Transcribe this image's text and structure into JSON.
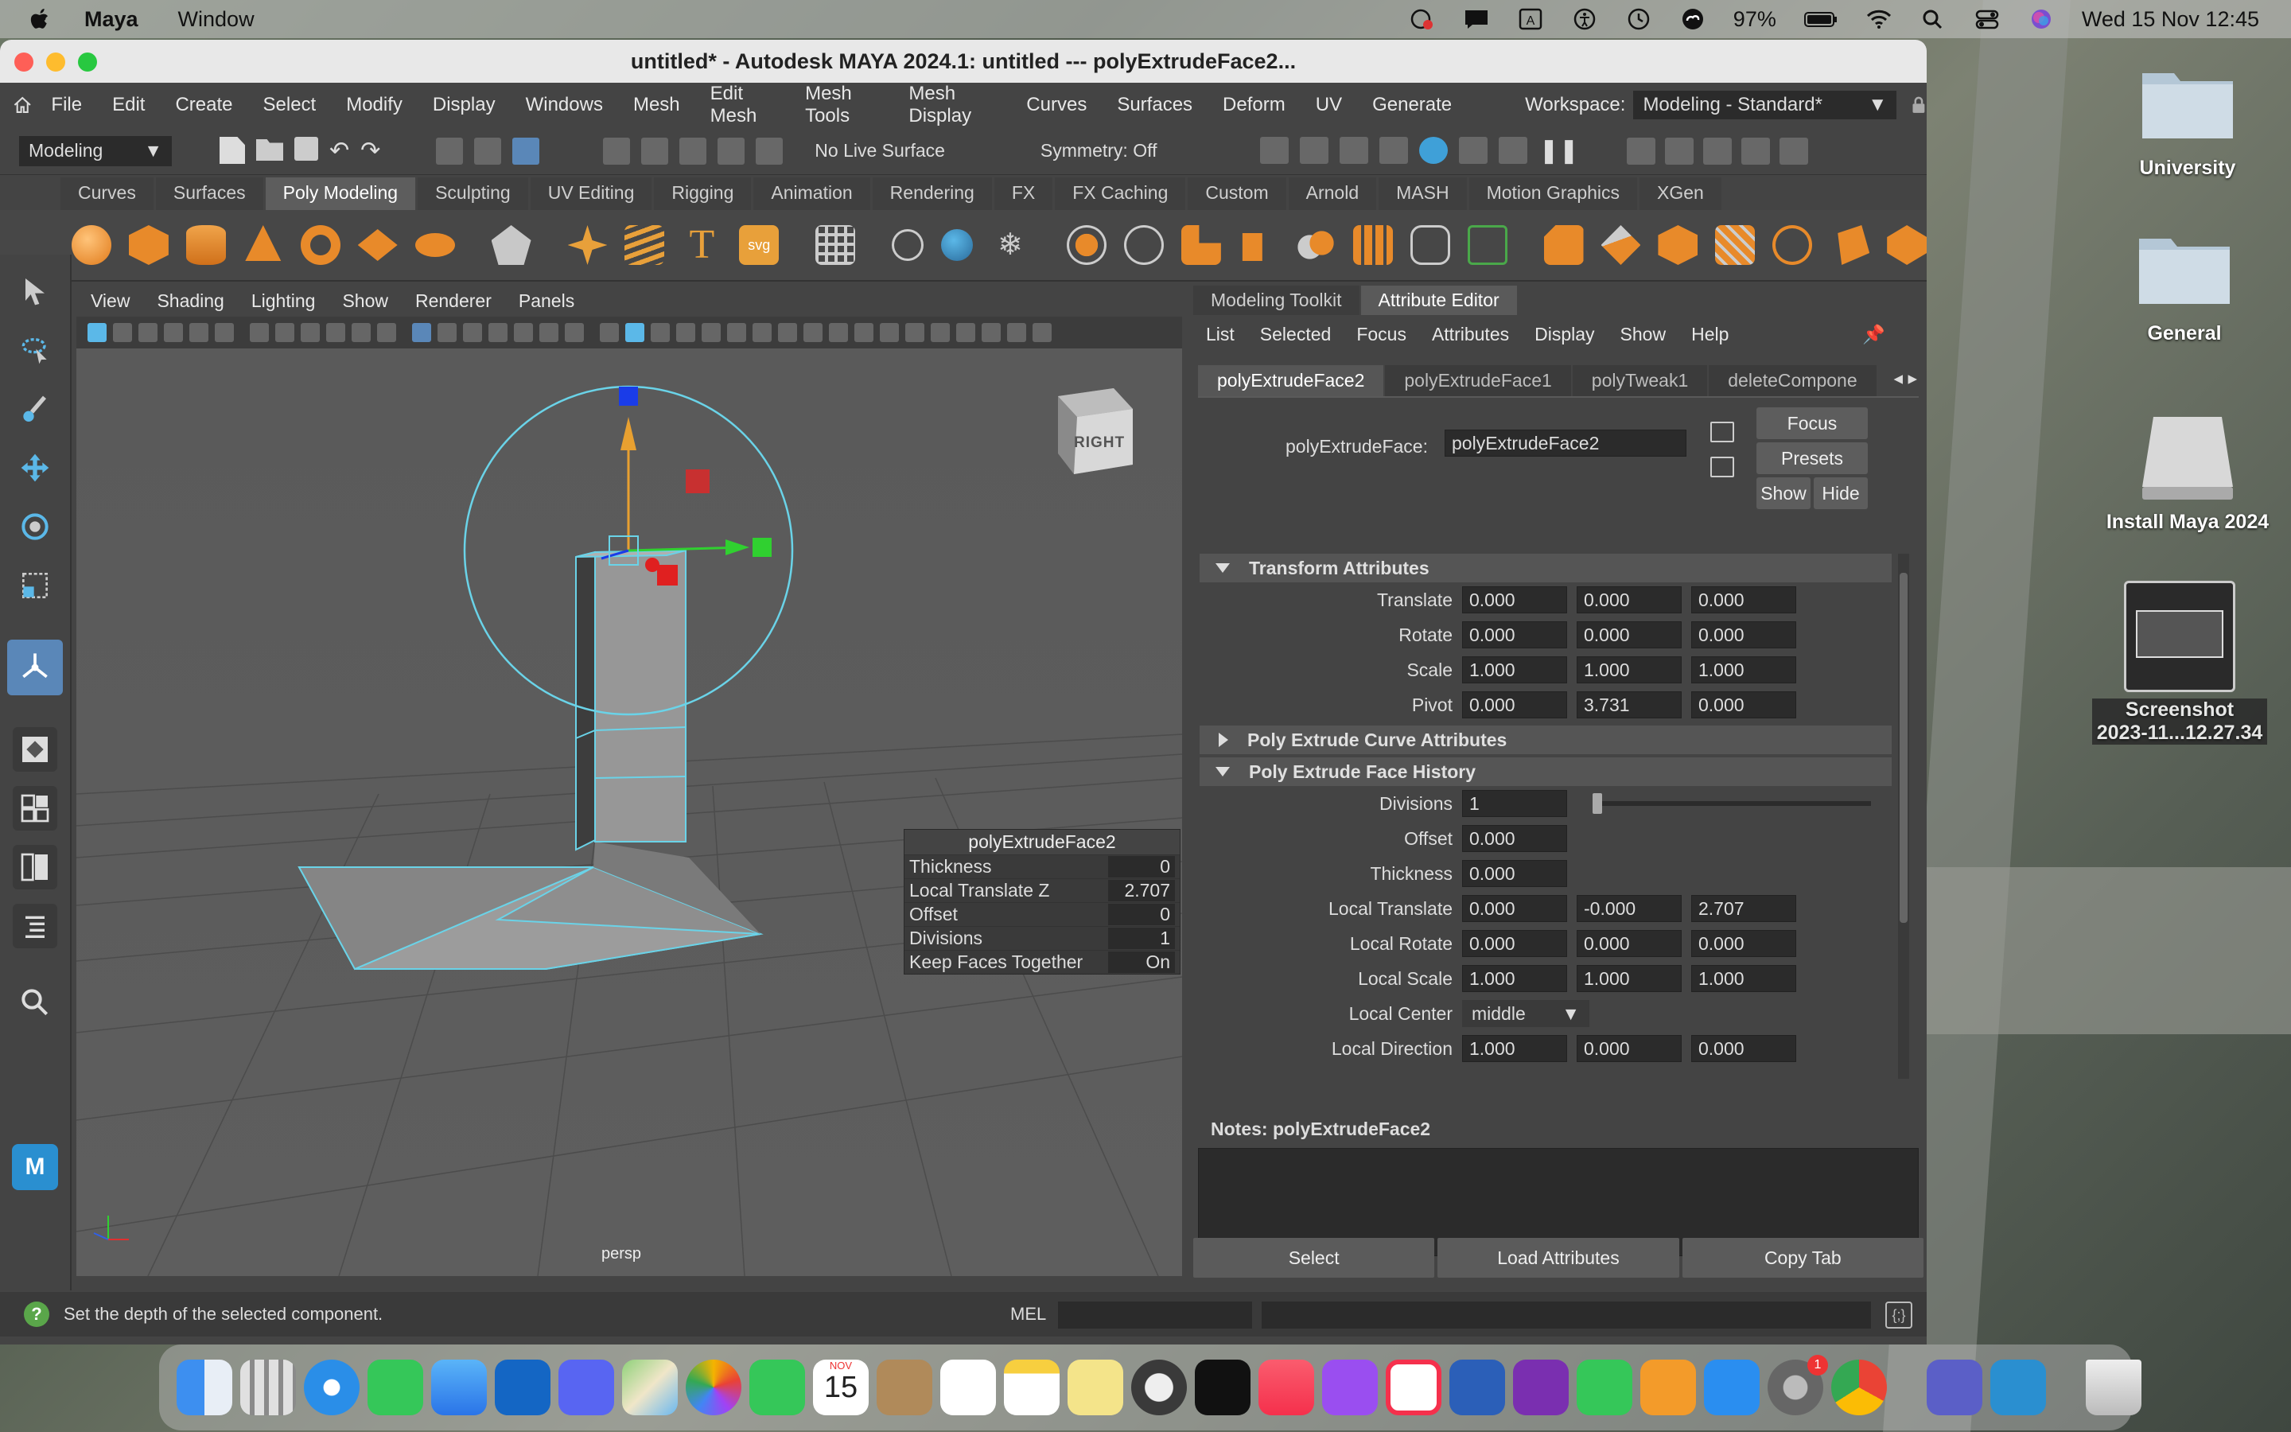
{
  "menubar": {
    "app": "Maya",
    "menu": "Window",
    "battery": "97%",
    "datetime": "Wed 15 Nov  12:45"
  },
  "window": {
    "title": "untitled* - Autodesk MAYA 2024.1: untitled   ---   polyExtrudeFace2..."
  },
  "main_menu": [
    "File",
    "Edit",
    "Create",
    "Select",
    "Modify",
    "Display",
    "Windows",
    "Mesh",
    "Edit Mesh",
    "Mesh Tools",
    "Mesh Display",
    "Curves",
    "Surfaces",
    "Deform",
    "UV",
    "Generate"
  ],
  "workspace": {
    "label": "Workspace:",
    "value": "Modeling - Standard*"
  },
  "statusline": {
    "menuset": "Modeling",
    "live_surface": "No Live Surface",
    "symmetry": "Symmetry: Off"
  },
  "shelf_tabs": [
    "Curves",
    "Surfaces",
    "Poly Modeling",
    "Sculpting",
    "UV Editing",
    "Rigging",
    "Animation",
    "Rendering",
    "FX",
    "FX Caching",
    "Custom",
    "Arnold",
    "MASH",
    "Motion Graphics",
    "XGen"
  ],
  "shelf_active": "Poly Modeling",
  "viewport": {
    "menu": [
      "View",
      "Shading",
      "Lighting",
      "Show",
      "Renderer",
      "Panels"
    ],
    "camera": "persp",
    "viewcube": "RIGHT"
  },
  "in_view_editor": {
    "title": "polyExtrudeFace2",
    "rows": [
      {
        "label": "Thickness",
        "value": "0"
      },
      {
        "label": "Local Translate Z",
        "value": "2.707"
      },
      {
        "label": "Offset",
        "value": "0"
      },
      {
        "label": "Divisions",
        "value": "1"
      },
      {
        "label": "Keep Faces Together",
        "value": "On"
      }
    ]
  },
  "attribute_editor": {
    "tabs": [
      "Modeling Toolkit",
      "Attribute Editor"
    ],
    "menu": [
      "List",
      "Selected",
      "Focus",
      "Attributes",
      "Display",
      "Show",
      "Help"
    ],
    "node_tabs": [
      "polyExtrudeFace2",
      "polyExtrudeFace1",
      "polyTweak1",
      "deleteCompone"
    ],
    "node_label": "polyExtrudeFace:",
    "node_value": "polyExtrudeFace2",
    "buttons": {
      "focus": "Focus",
      "presets": "Presets",
      "show": "Show",
      "hide": "Hide"
    },
    "sections": {
      "transform": "Transform Attributes",
      "curve": "Poly Extrude Curve Attributes",
      "history": "Poly Extrude Face History"
    },
    "transform_rows": [
      {
        "label": "Translate",
        "values": [
          "0.000",
          "0.000",
          "0.000"
        ]
      },
      {
        "label": "Rotate",
        "values": [
          "0.000",
          "0.000",
          "0.000"
        ]
      },
      {
        "label": "Scale",
        "values": [
          "1.000",
          "1.000",
          "1.000"
        ]
      },
      {
        "label": "Pivot",
        "values": [
          "0.000",
          "3.731",
          "0.000"
        ]
      }
    ],
    "history_rows": [
      {
        "label": "Divisions",
        "values": [
          "1"
        ]
      },
      {
        "label": "Offset",
        "values": [
          "0.000"
        ]
      },
      {
        "label": "Thickness",
        "values": [
          "0.000"
        ]
      },
      {
        "label": "Local Translate",
        "values": [
          "0.000",
          "-0.000",
          "2.707"
        ]
      },
      {
        "label": "Local Rotate",
        "values": [
          "0.000",
          "0.000",
          "0.000"
        ]
      },
      {
        "label": "Local Scale",
        "values": [
          "1.000",
          "1.000",
          "1.000"
        ]
      },
      {
        "label": "Local Center",
        "values": [
          "middle"
        ]
      },
      {
        "label": "Local Direction",
        "values": [
          "1.000",
          "0.000",
          "0.000"
        ]
      }
    ],
    "notes_label": "Notes:  polyExtrudeFace2",
    "bottom": [
      "Select",
      "Load Attributes",
      "Copy Tab"
    ]
  },
  "helpline": {
    "text": "Set the depth of the selected component.",
    "mel": "MEL"
  },
  "desktop": [
    {
      "name": "University"
    },
    {
      "name": "General"
    },
    {
      "name": "Install Maya 2024"
    },
    {
      "name": "Screenshot",
      "sub": "2023-11...12.27.34"
    }
  ],
  "dock": {
    "calendar_month": "NOV",
    "calendar_day": "15",
    "settings_badge": "1"
  },
  "colors": {
    "maya_bg": "#444444",
    "viewport": "#5b5b5b",
    "field": "#2b2b2b",
    "manip_ring": "#6ad3e8"
  }
}
